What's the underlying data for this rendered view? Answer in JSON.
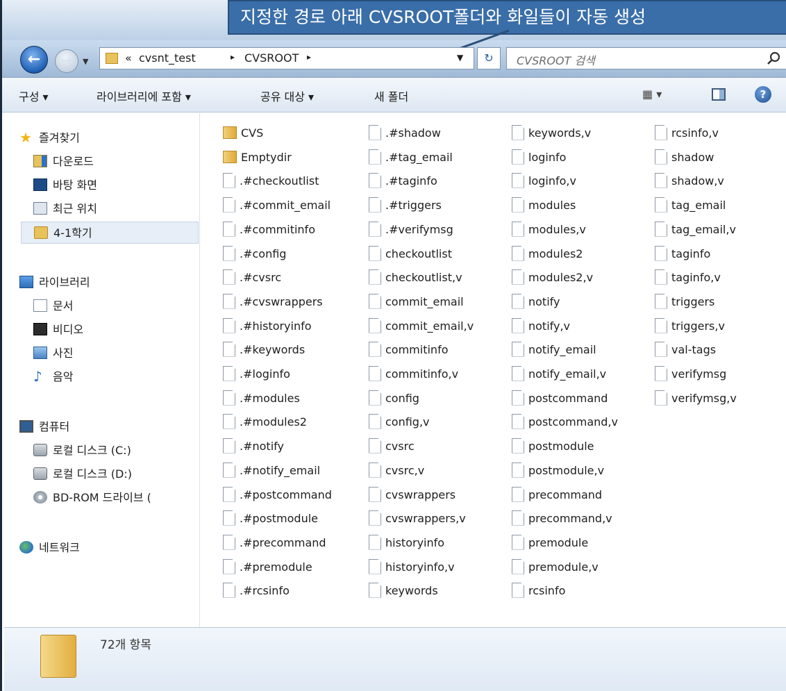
{
  "callout": {
    "text": "지정한 경로 아래 CVSROOT폴더와 화일들이 자동 생성"
  },
  "address": {
    "overflow": "«",
    "crumbs": [
      "cvsnt_test",
      "CVSROOT"
    ],
    "separator": "▸"
  },
  "search": {
    "placeholder": "CVSROOT 검색"
  },
  "toolbar": {
    "organize": "구성 ▾",
    "include_library": "라이브러리에 포함 ▾",
    "share_with": "공유 대상 ▾",
    "new_folder": "새 폴더"
  },
  "nav": {
    "favorites": "즐겨찾기",
    "downloads": "다운로드",
    "desktop": "바탕 화면",
    "recent": "최근 위치",
    "term": "4-1학기",
    "libraries": "라이브러리",
    "documents": "문서",
    "videos": "비디오",
    "pictures": "사진",
    "music": "음악",
    "computer": "컴퓨터",
    "disk_c": "로컬 디스크 (C:)",
    "disk_d": "로컬 디스크 (D:)",
    "bd_rom": "BD-ROM 드라이브 (",
    "network": "네트워크"
  },
  "files": {
    "col1": [
      {
        "name": "CVS",
        "type": "folder"
      },
      {
        "name": "Emptydir",
        "type": "folder"
      },
      {
        "name": ".#checkoutlist",
        "type": "file"
      },
      {
        "name": ".#commit_email",
        "type": "file"
      },
      {
        "name": ".#commitinfo",
        "type": "file"
      },
      {
        "name": ".#config",
        "type": "file"
      },
      {
        "name": ".#cvsrc",
        "type": "file"
      },
      {
        "name": ".#cvswrappers",
        "type": "file"
      },
      {
        "name": ".#historyinfo",
        "type": "file"
      },
      {
        "name": ".#keywords",
        "type": "file"
      },
      {
        "name": ".#loginfo",
        "type": "file"
      },
      {
        "name": ".#modules",
        "type": "file"
      },
      {
        "name": ".#modules2",
        "type": "file"
      },
      {
        "name": ".#notify",
        "type": "file"
      },
      {
        "name": ".#notify_email",
        "type": "file"
      },
      {
        "name": ".#postcommand",
        "type": "file"
      },
      {
        "name": ".#postmodule",
        "type": "file"
      },
      {
        "name": ".#precommand",
        "type": "file"
      },
      {
        "name": ".#premodule",
        "type": "file"
      },
      {
        "name": ".#rcsinfo",
        "type": "file"
      }
    ],
    "col2": [
      ".#shadow",
      ".#tag_email",
      ".#taginfo",
      ".#triggers",
      ".#verifymsg",
      "checkoutlist",
      "checkoutlist,v",
      "commit_email",
      "commit_email,v",
      "commitinfo",
      "commitinfo,v",
      "config",
      "config,v",
      "cvsrc",
      "cvsrc,v",
      "cvswrappers",
      "cvswrappers,v",
      "historyinfo",
      "historyinfo,v",
      "keywords"
    ],
    "col3": [
      "keywords,v",
      "loginfo",
      "loginfo,v",
      "modules",
      "modules,v",
      "modules2",
      "modules2,v",
      "notify",
      "notify,v",
      "notify_email",
      "notify_email,v",
      "postcommand",
      "postcommand,v",
      "postmodule",
      "postmodule,v",
      "precommand",
      "precommand,v",
      "premodule",
      "premodule,v",
      "rcsinfo"
    ],
    "col4": [
      "rcsinfo,v",
      "shadow",
      "shadow,v",
      "tag_email",
      "tag_email,v",
      "taginfo",
      "taginfo,v",
      "triggers",
      "triggers,v",
      "val-tags",
      "verifymsg",
      "verifymsg,v"
    ]
  },
  "status": {
    "item_count": "72개 항목"
  }
}
